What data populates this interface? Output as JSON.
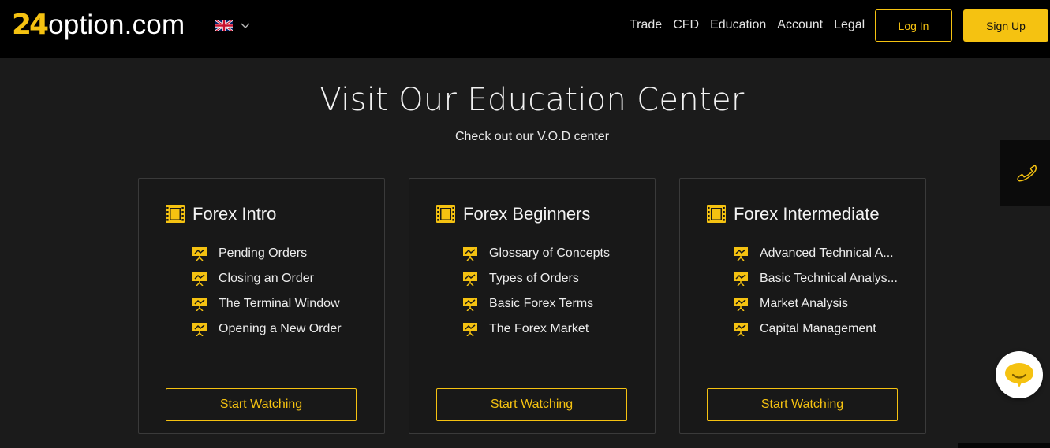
{
  "brand": {
    "logo_number": "24",
    "logo_text": "option.com",
    "accent_color": "#f5c211"
  },
  "language": {
    "current": "English (UK)",
    "icon": "uk-flag-icon"
  },
  "nav": {
    "items": [
      {
        "label": "Trade"
      },
      {
        "label": "CFD"
      },
      {
        "label": "Education"
      },
      {
        "label": "Account"
      },
      {
        "label": "Legal"
      }
    ],
    "login_label": "Log In",
    "signup_label": "Sign Up"
  },
  "hero": {
    "title": "Visit Our Education Center",
    "subtitle": "Check out our V.O.D center"
  },
  "courses": [
    {
      "title": "Forex Intro",
      "lessons": [
        "Pending Orders",
        "Closing an Order",
        "The Terminal Window",
        "Opening a New Order"
      ],
      "button": "Start Watching"
    },
    {
      "title": "Forex Beginners",
      "lessons": [
        "Glossary of Concepts",
        "Types of Orders",
        "Basic Forex Terms",
        "The Forex Market"
      ],
      "button": "Start Watching"
    },
    {
      "title": "Forex Intermediate",
      "lessons": [
        "Advanced Technical A...",
        "Basic Technical Analys...",
        "Market Analysis",
        "Capital Management"
      ],
      "button": "Start Watching"
    }
  ],
  "widgets": {
    "phone_icon": "phone-icon",
    "chat_icon": "chat-icon"
  }
}
